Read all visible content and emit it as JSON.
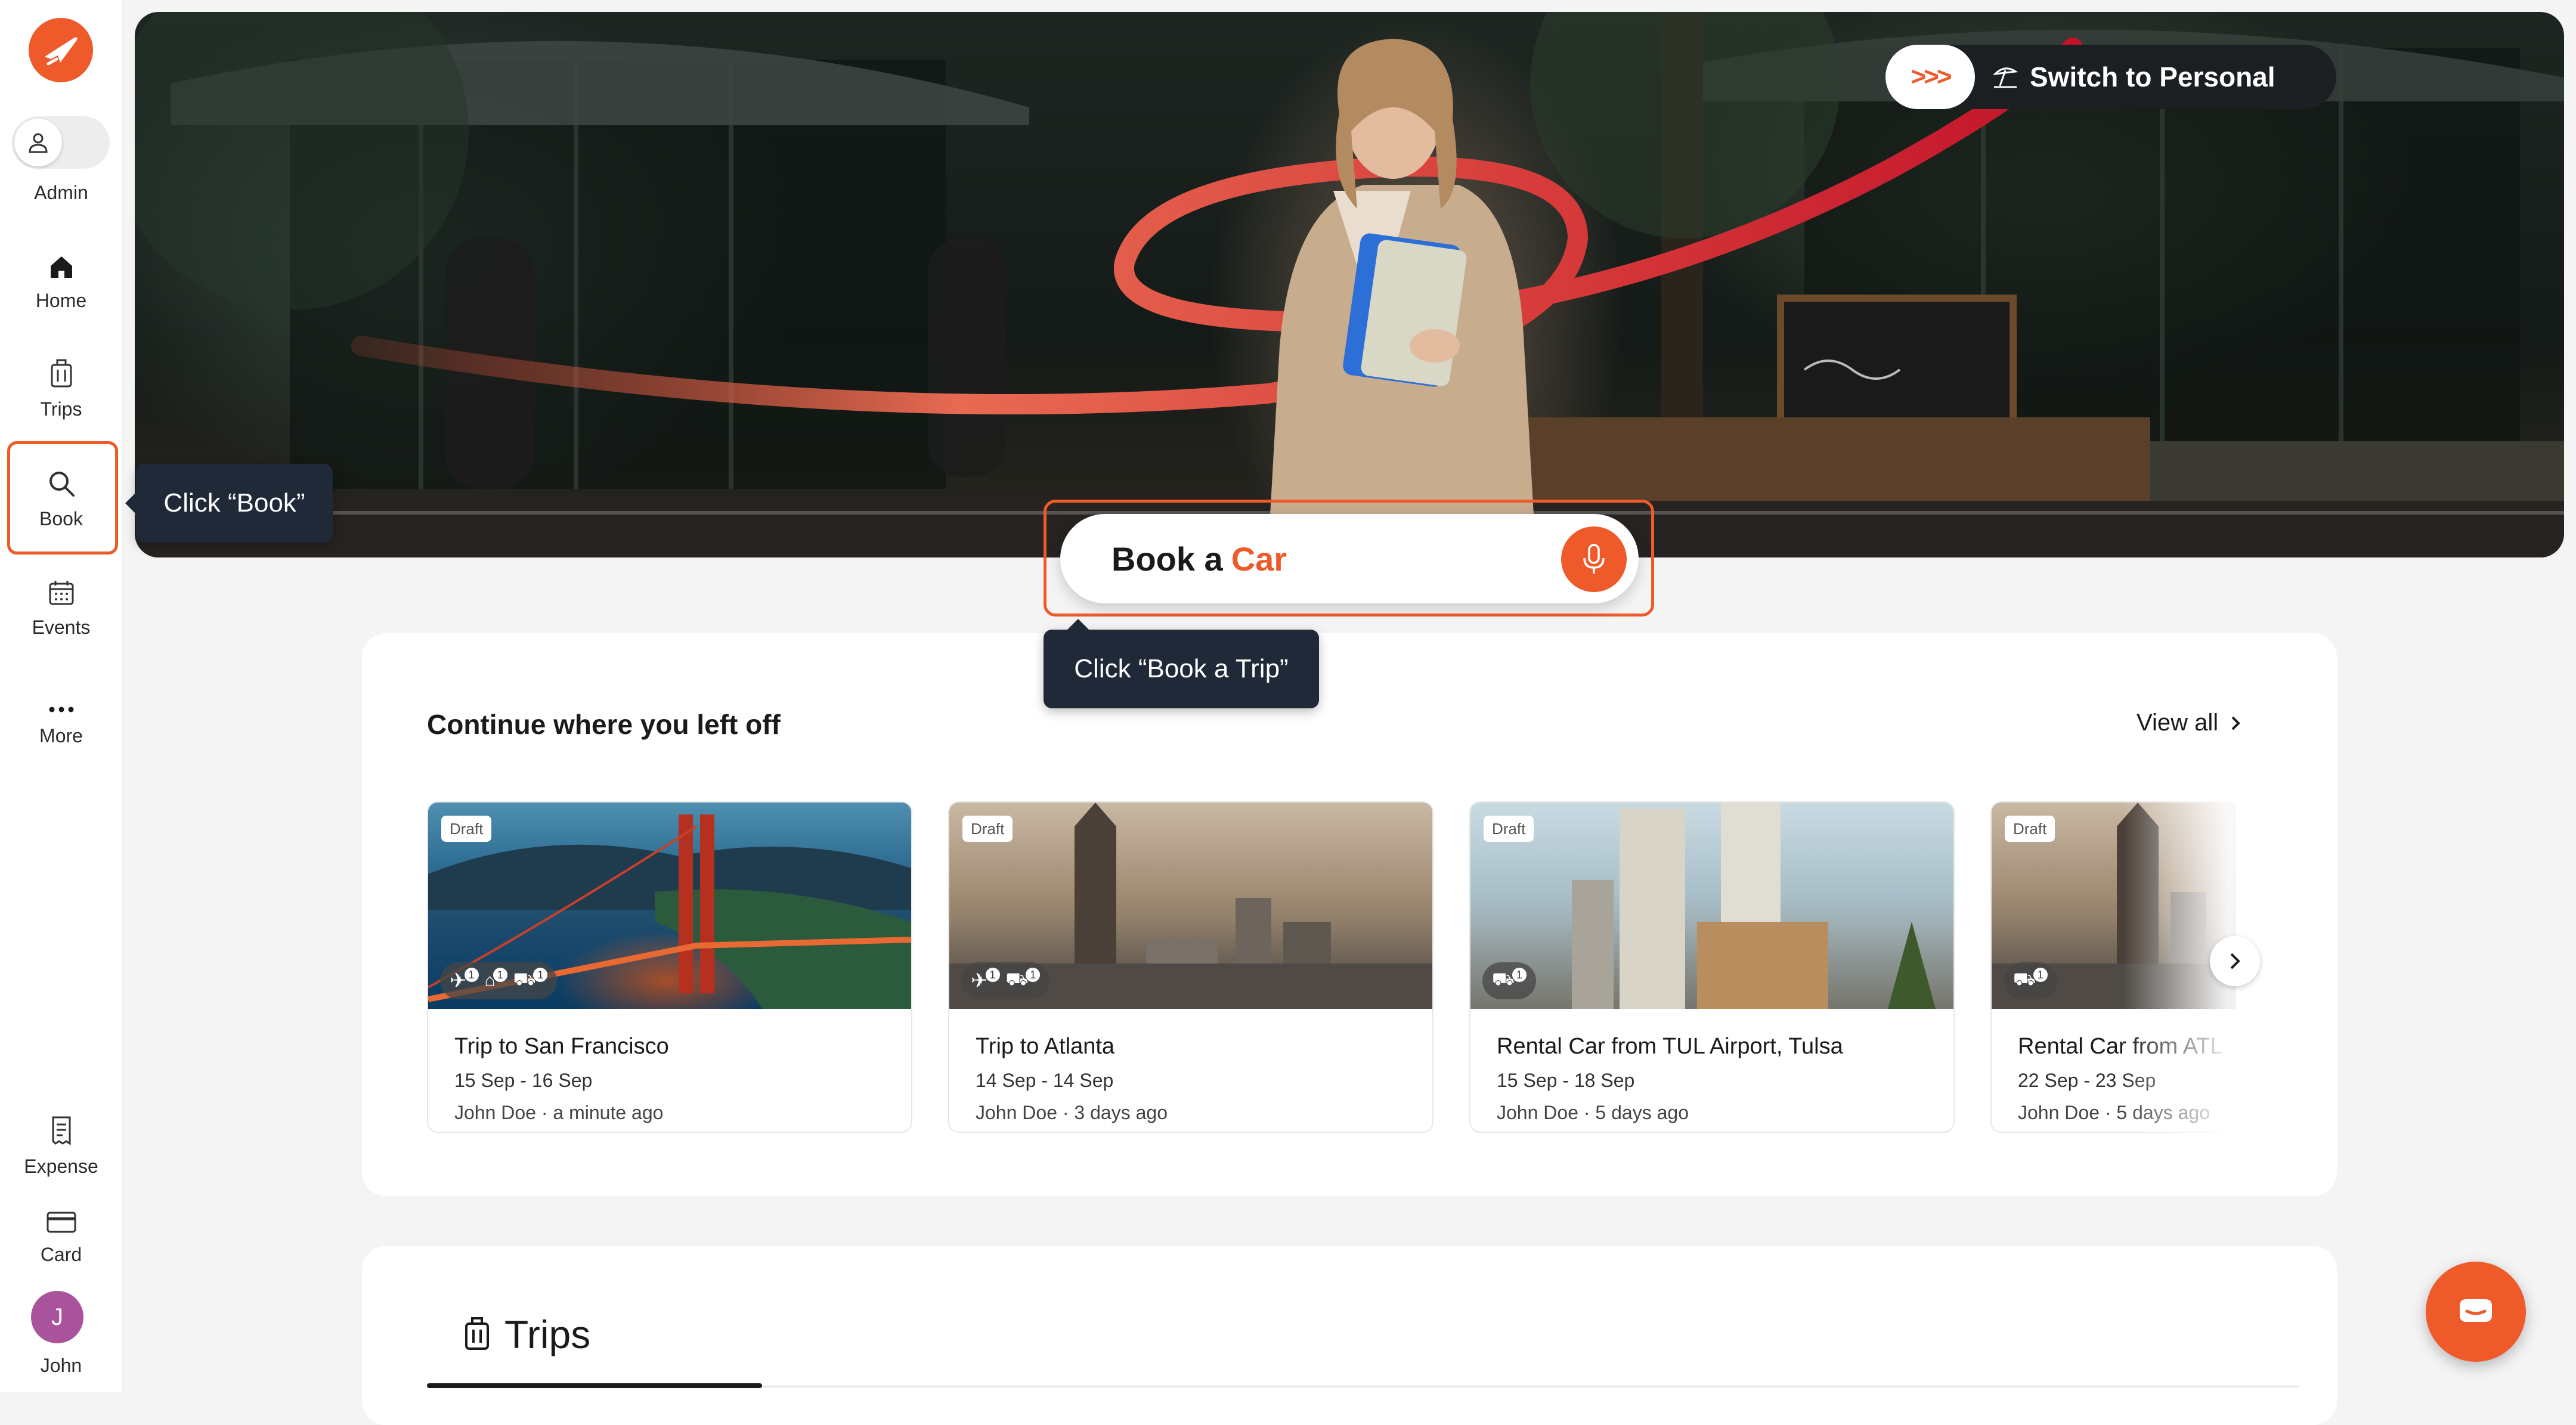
{
  "sidebar": {
    "admin_label": "Admin",
    "items": [
      {
        "label": "Home",
        "icon": "home-icon"
      },
      {
        "label": "Trips",
        "icon": "luggage-icon"
      },
      {
        "label": "Book",
        "icon": "search-icon"
      },
      {
        "label": "Events",
        "icon": "calendar-icon"
      },
      {
        "label": "More",
        "icon": "more-icon"
      }
    ],
    "bottom_items": [
      {
        "label": "Expense",
        "icon": "receipt-icon"
      },
      {
        "label": "Card",
        "icon": "card-icon"
      }
    ],
    "user": {
      "initial": "J",
      "name": "John"
    }
  },
  "tooltips": {
    "book": "Click “Book”",
    "book_trip": "Click “Book a Trip”"
  },
  "hero": {
    "switch_label": "Switch to Personal",
    "switch_arrows": ">>>",
    "search": {
      "prefix": "Book a",
      "highlight": "Car"
    }
  },
  "continue_section": {
    "title": "Continue where you left off",
    "view_all": "View all",
    "cards": [
      {
        "badge": "Draft",
        "title": "Trip to San Francisco",
        "dates": "15 Sep - 16 Sep",
        "meta": "John Doe · a minute ago",
        "counts": [
          "1",
          "1",
          "1"
        ]
      },
      {
        "badge": "Draft",
        "title": "Trip to Atlanta",
        "dates": "14 Sep - 14 Sep",
        "meta": "John Doe · 3 days ago",
        "counts": [
          "1",
          "1"
        ]
      },
      {
        "badge": "Draft",
        "title": "Rental Car from TUL Airport, Tulsa",
        "dates": "15 Sep - 18 Sep",
        "meta": "John Doe · 5 days ago",
        "counts": [
          "1"
        ]
      },
      {
        "badge": "Draft",
        "title": "Rental Car from ATL",
        "dates": "22 Sep - 23 Sep",
        "meta": "John Doe · 5 days ago",
        "counts": [
          "1"
        ]
      }
    ]
  },
  "trips_section": {
    "title": "Trips"
  },
  "colors": {
    "accent": "#ee5a2a",
    "dark": "#1f2937",
    "avatar": "#a8539c"
  }
}
